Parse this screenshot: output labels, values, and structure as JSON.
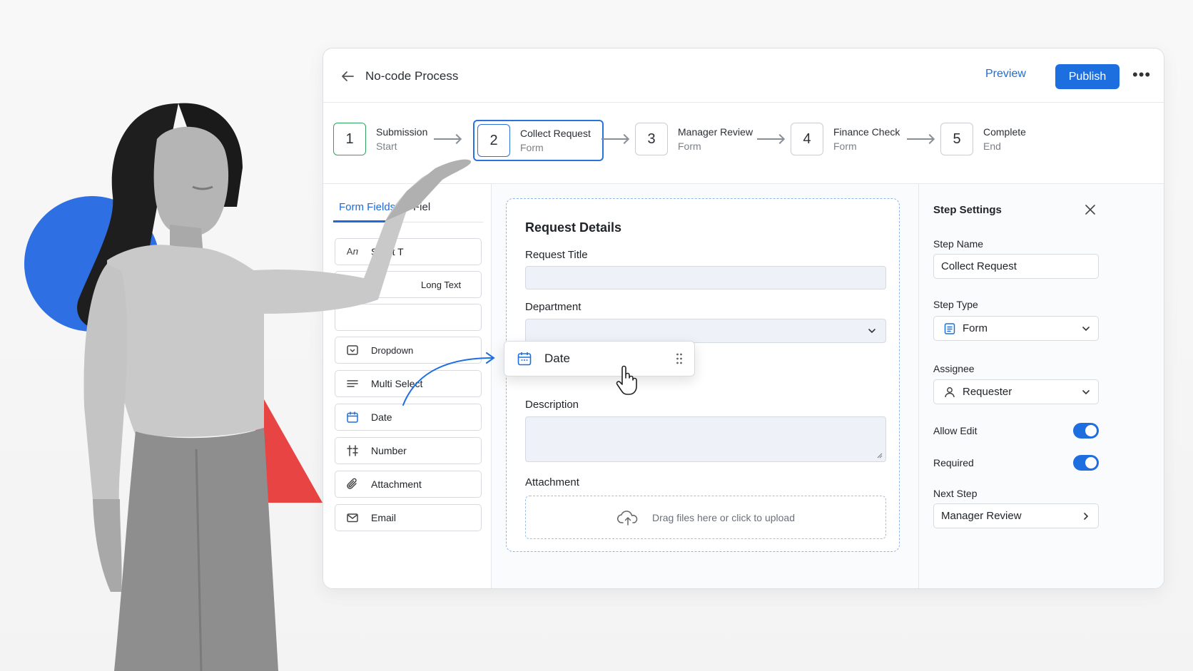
{
  "header": {
    "title": "No-code Process",
    "preview_label": "Preview",
    "publish_label": "Publish"
  },
  "steps": [
    {
      "num": "1",
      "title": "Submission",
      "sub": "Start"
    },
    {
      "num": "2",
      "title": "Collect Request",
      "sub": "Form"
    },
    {
      "num": "3",
      "title": "Manager Review",
      "sub": "Form"
    },
    {
      "num": "4",
      "title": "Finance Check",
      "sub": "Form"
    },
    {
      "num": "5",
      "title": "Complete",
      "sub": "End"
    }
  ],
  "left_panel": {
    "tabs": [
      "Form Fields",
      "Fiel"
    ],
    "fields": [
      {
        "icon_text": "Aⴖ",
        "label": "Short T"
      },
      {
        "icon_text": "",
        "label": "Long Text"
      },
      {
        "icon_text": "",
        "label": ""
      },
      {
        "icon": "dropdown-icon",
        "label": "Dropdown"
      },
      {
        "icon": "multi-select-icon",
        "label": "Multi Select"
      },
      {
        "icon": "calendar-icon",
        "label": "Date"
      },
      {
        "icon": "number-icon",
        "label": "Number"
      },
      {
        "icon": "paperclip-icon",
        "label": "Attachment"
      },
      {
        "icon": "mail-icon",
        "label": "Email"
      }
    ]
  },
  "canvas": {
    "section_title": "Request Details",
    "labels": {
      "request_title": "Request Title",
      "department": "Department",
      "description": "Description",
      "attachment": "Attachment"
    },
    "upload_text": "Drag files here or click to upload",
    "drag_card_label": "Date"
  },
  "settings": {
    "title": "Step Settings",
    "step_name_label": "Step Name",
    "step_name_value": "Collect Request",
    "step_type_label": "Step Type",
    "step_type_value": "Form",
    "assignee_label": "Assignee",
    "assignee_value": "Requester",
    "allow_edit_label": "Allow Edit",
    "allow_edit_on": true,
    "required_label": "Required",
    "required_on": true,
    "next_step_label": "Next Step",
    "next_step_value": "Manager Review"
  },
  "colors": {
    "accent": "#1d6fe0",
    "done_step": "#2fa35d",
    "deco_blue": "#2f6fe4",
    "deco_red": "#e94444"
  }
}
